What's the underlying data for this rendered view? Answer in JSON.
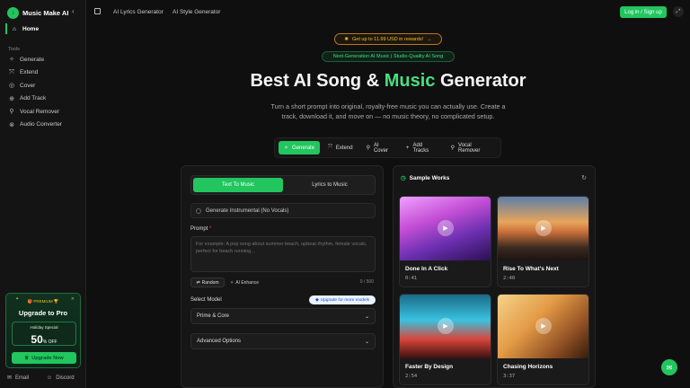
{
  "app": {
    "name": "Music Make AI"
  },
  "sidebar": {
    "home_label": "Home",
    "tools_label": "Tools",
    "items": [
      {
        "label": "Generate",
        "icon": "sparkles-icon"
      },
      {
        "label": "Extend",
        "icon": "extend-icon"
      },
      {
        "label": "Cover",
        "icon": "disc-icon"
      },
      {
        "label": "Add Track",
        "icon": "plus-circle-icon"
      },
      {
        "label": "Vocal Remover",
        "icon": "mic-off-icon"
      },
      {
        "label": "Audio Converter",
        "icon": "convert-icon"
      }
    ],
    "promo": {
      "badge": "PREMIUM",
      "title": "Upgrade to Pro",
      "deal_label": "Holiday Special",
      "deal_value": "50",
      "deal_suffix": "% OFF",
      "button": "Upgrade Now"
    },
    "footer": {
      "email": "Email",
      "discord": "Discord"
    }
  },
  "topbar": {
    "links": [
      "AI Lyrics Generator",
      "AI Style Generator"
    ],
    "login": "Log in / Sign up"
  },
  "hero": {
    "reward": "Get up to 11.99 USD in rewards!",
    "tagline": "Next-Generation AI Music | Studio-Quality AI Song",
    "title_pre": "Best AI Song & ",
    "title_accent": "Music",
    "title_post": " Generator",
    "description": "Turn a short prompt into original, royalty-free music you can actually use. Create a track, download it, and move on — no music theory, no complicated setup."
  },
  "tabs": [
    {
      "label": "Generate",
      "active": true
    },
    {
      "label": "Extend"
    },
    {
      "label": "AI Cover"
    },
    {
      "label": "Add Tracks"
    },
    {
      "label": "Vocal Remover"
    }
  ],
  "form": {
    "mode_text": "Text To Music",
    "mode_lyrics": "Lyrics to Music",
    "instrumental": "Generate Instrumental (No Vocals)",
    "prompt_label": "Prompt",
    "prompt_required": "*",
    "prompt_placeholder": "For example: A pop song about summer beach, upbeat rhythm, female vocals, perfect for beach running...",
    "random": "Random",
    "enhance": "AI Enhance",
    "count": "0 / 500",
    "model_label": "Select Model",
    "model_upgrade": "Upgrade for more models",
    "model_value": "Prime & Core",
    "advanced": "Advanced Options"
  },
  "samples": {
    "title": "Sample Works",
    "cards": [
      {
        "title": "Done In A Click",
        "duration": "0:41"
      },
      {
        "title": "Rise To What's Next",
        "duration": "2:40"
      },
      {
        "title": "Faster By Design",
        "duration": "2:54"
      },
      {
        "title": "Chasing Horizons",
        "duration": "3:37"
      }
    ]
  },
  "colors": {
    "accent": "#22c55e",
    "gold": "#fbbf24"
  }
}
